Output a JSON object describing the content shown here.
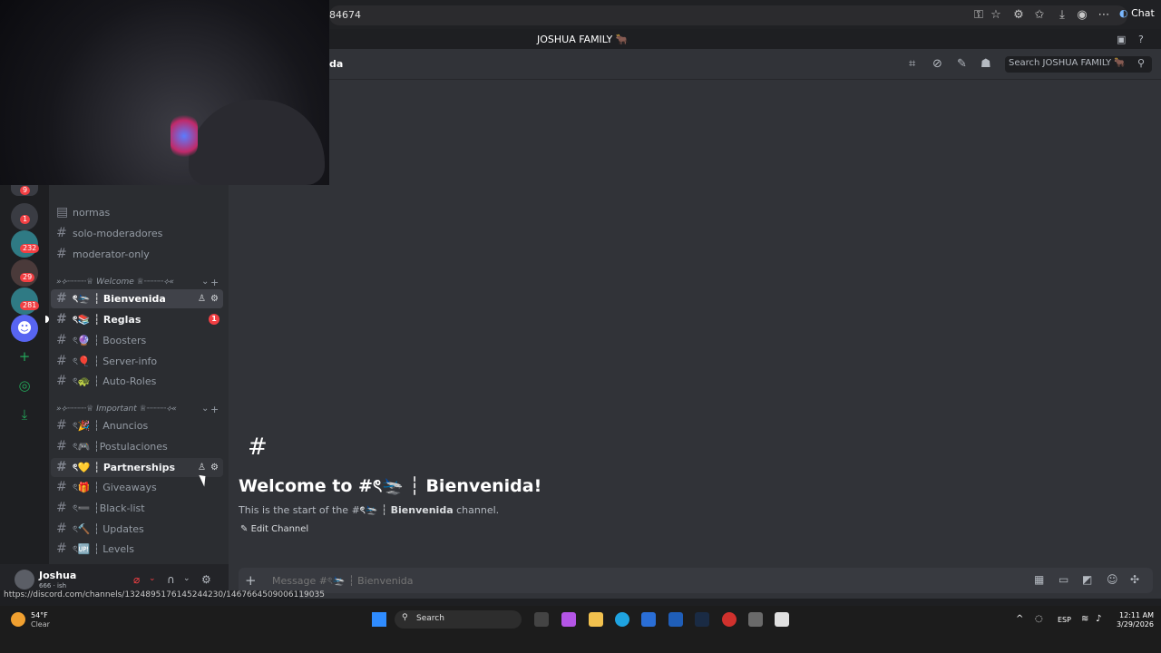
{
  "browser": {
    "url_fragment": "84674",
    "chat_label": "Chat"
  },
  "server": {
    "title": "JOSHUA FAMILY 🐂"
  },
  "header": {
    "channel_fragment": "da",
    "search_placeholder": "Search JOSHUA FAMILY 🐂"
  },
  "guilds": [
    {
      "badge": "9"
    },
    {
      "badge": "1"
    },
    {
      "badge": "232"
    },
    {
      "badge": "29"
    },
    {
      "badge": "281"
    }
  ],
  "channels": {
    "top": [
      "normas",
      "solo-moderadores",
      "moderator-only"
    ],
    "category_welcome": "»⟡┈┈┈┈♕ Welcome ♕┈┈┈┈⟡«",
    "welcome_items": [
      "ৎ🛬 ┆ Bienvenida",
      "ৎ📚 ┆ Reglas",
      "ৎ🔮 ┆ Boosters",
      "ৎ🎈 ┆ Server-info",
      "ৎ🐢 ┆ Auto-Roles"
    ],
    "reglas_badge": "1",
    "category_important": "»⟡┈┈┈┈♕ Important ♕┈┈┈┈⟡«",
    "important_items": [
      "ৎ🎉 ┆ Anuncios",
      "ৎ🎮 ┆Postulaciones",
      "ৎ💛 ┆ Partnerships",
      "ৎ🎁 ┆ Giveaways",
      "ৎ➖ ┆Black-list",
      "ৎ🔨 ┆ Updates",
      "ৎ🆙 ┆ Levels"
    ]
  },
  "user": {
    "name": "Joshua",
    "status": "666 · ish"
  },
  "welcome": {
    "hash": "#",
    "title": "Welcome to #ৎ🛬 ┆ Bienvenida!",
    "subtitle_pre": "This is the start of the #",
    "subtitle_channel": "ৎ🛬 ┆ Bienvenida",
    "subtitle_post": " channel.",
    "edit_label": "Edit Channel"
  },
  "composer": {
    "placeholder": "Message #ৎ🛬 ┆ Bienvenida"
  },
  "status_url": "https://discord.com/channels/1324895176145244230/1467664509006119035",
  "taskbar": {
    "temp": "54°F",
    "weather": "Clear",
    "search": "Search",
    "lang": "ESP",
    "time": "12:11 AM",
    "date": "3/29/2026"
  }
}
